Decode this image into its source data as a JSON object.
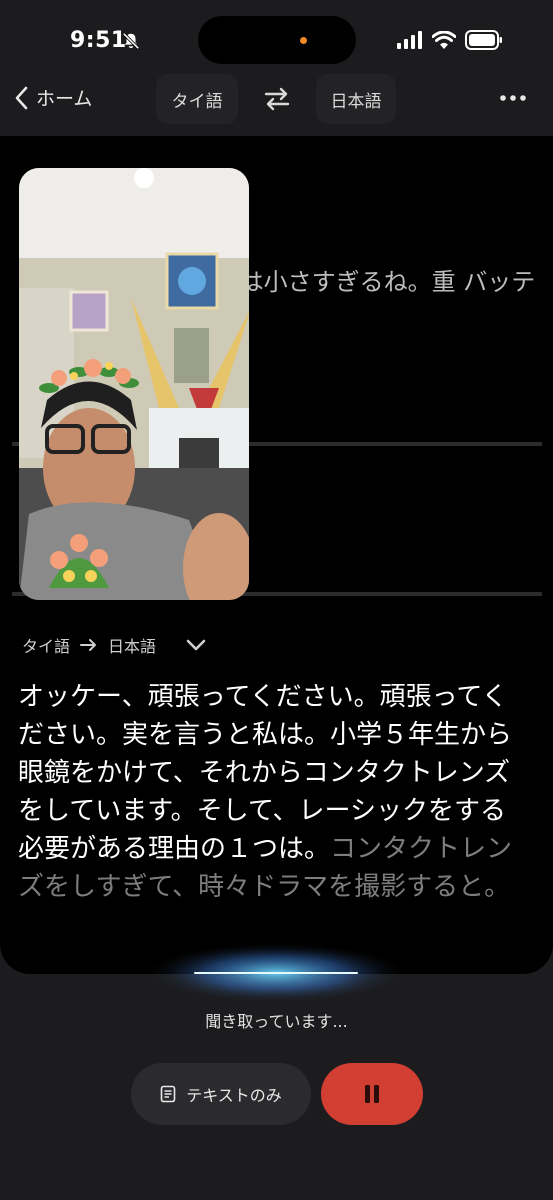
{
  "status": {
    "time": "9:51"
  },
  "header": {
    "back_label": "ホーム",
    "source_lang": "タイ語",
    "target_lang": "日本語"
  },
  "previous_translation": "ら。彼を入れに来て は小さすぎるね。重 バッテリーを入れ せん。",
  "lang_row": {
    "from": "タイ語",
    "to": "日本語"
  },
  "transcript": {
    "final": "オッケー、頑張ってください。頑張ってください。実を言うと私は。小学５年生から眼鏡をかけて、それからコンタクトレンズをしています。そして、レーシックをする必要がある理由の１つは。",
    "pending": "コンタクトレンズをしすぎて、時々ドラマを撮影すると。"
  },
  "listening_label": "聞き取っています...",
  "controls": {
    "text_only_label": "テキストのみ"
  },
  "colors": {
    "accent_red": "#d13f33",
    "background": "#1c1c1e",
    "card": "#000000"
  }
}
